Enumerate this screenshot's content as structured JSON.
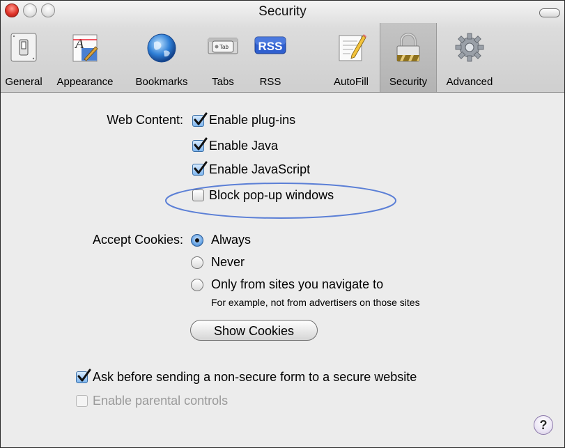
{
  "window": {
    "title": "Security"
  },
  "toolbar": {
    "items": [
      {
        "label": "General",
        "icon": "light-switch-icon",
        "selected": false
      },
      {
        "label": "Appearance",
        "icon": "font-brush-icon",
        "selected": false
      },
      {
        "label": "Bookmarks",
        "icon": "globe-icon",
        "selected": false
      },
      {
        "label": "Tabs",
        "icon": "tab-icon",
        "tab_text": "Tab",
        "selected": false
      },
      {
        "label": "RSS",
        "icon": "rss-icon",
        "icon_text": "RSS",
        "selected": false
      },
      {
        "label": "AutoFill",
        "icon": "pencil-form-icon",
        "selected": false
      },
      {
        "label": "Security",
        "icon": "padlock-icon",
        "selected": true
      },
      {
        "label": "Advanced",
        "icon": "gear-icon",
        "selected": false
      }
    ]
  },
  "web_content": {
    "label": "Web Content:",
    "options": [
      {
        "label": "Enable plug-ins",
        "checked": true
      },
      {
        "label": "Enable Java",
        "checked": true
      },
      {
        "label": "Enable JavaScript",
        "checked": true
      },
      {
        "label": "Block pop-up windows",
        "checked": false
      }
    ]
  },
  "cookies": {
    "label": "Accept Cookies:",
    "options": [
      {
        "label": "Always",
        "selected": true
      },
      {
        "label": "Never",
        "selected": false
      },
      {
        "label": "Only from sites you navigate to",
        "selected": false
      }
    ],
    "hint": "For example, not from advertisers on those sites",
    "show_button": "Show Cookies"
  },
  "ask_nonsecure": {
    "label": "Ask before sending a non-secure form to a secure website",
    "checked": true
  },
  "parental": {
    "label": "Enable parental controls",
    "checked": false,
    "enabled": false
  },
  "help": {
    "label": "?"
  },
  "colors": {
    "highlight_ellipse": "#5b7fd6",
    "checkbox_checked": "#7fb6ef",
    "window_bg": "#ececec"
  }
}
